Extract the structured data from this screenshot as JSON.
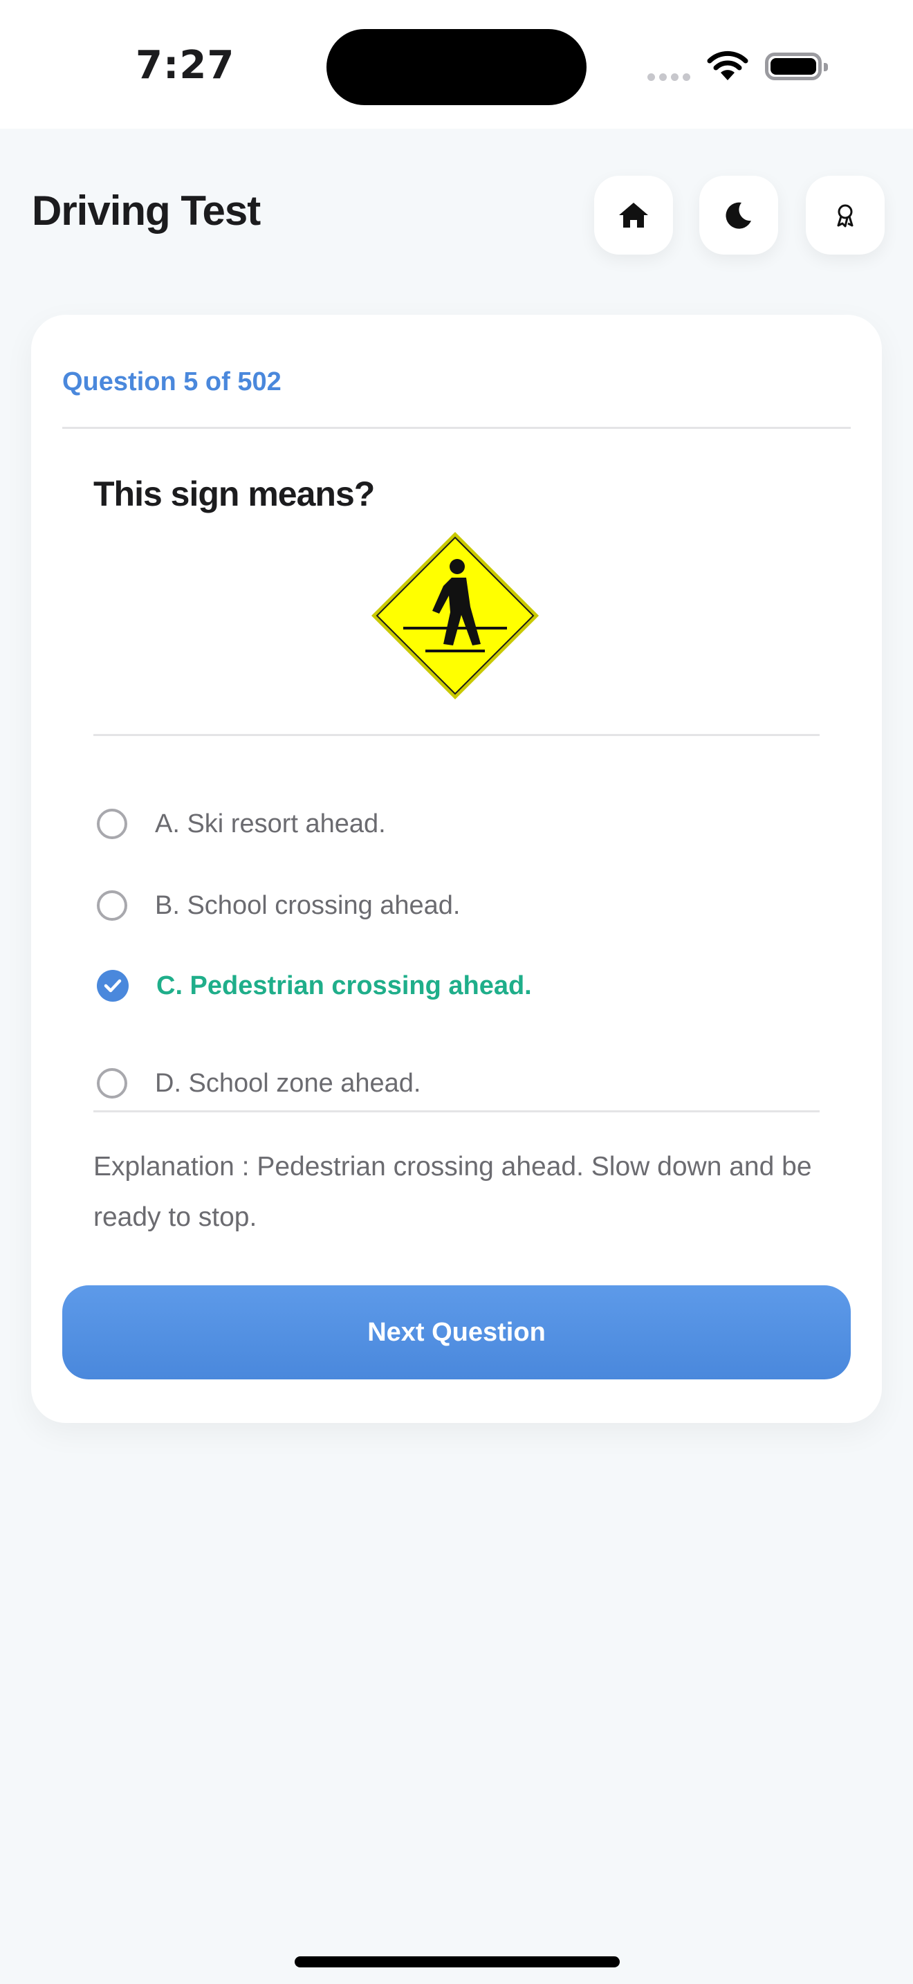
{
  "status_bar": {
    "time": "7:27"
  },
  "header": {
    "title": "Driving Test",
    "buttons": [
      {
        "icon": "home-icon"
      },
      {
        "icon": "moon-icon"
      },
      {
        "icon": "award-icon"
      }
    ]
  },
  "quiz": {
    "counter": "Question 5 of 502",
    "question": "This sign means?",
    "sign_icon": "pedestrian-crossing-sign",
    "options": [
      {
        "label": "A. Ski resort ahead.",
        "selected": false
      },
      {
        "label": "B. School crossing ahead.",
        "selected": false
      },
      {
        "label": "C. Pedestrian crossing ahead.",
        "selected": true
      },
      {
        "label": "D. School zone ahead.",
        "selected": false
      }
    ],
    "explanation": "Explanation : Pedestrian crossing ahead. Slow down and be ready to stop.",
    "next_label": "Next Question"
  },
  "colors": {
    "accent": "#4a88dc",
    "correct": "#1fae8a",
    "sign_yellow": "#ffff00",
    "background": "#f5f8fa"
  }
}
